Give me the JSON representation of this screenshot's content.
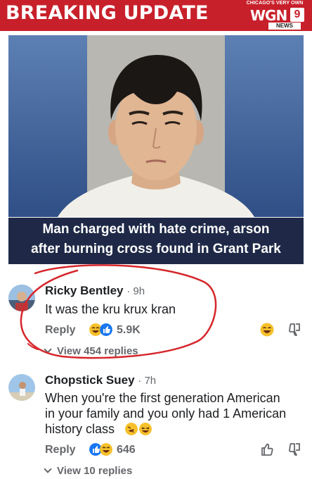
{
  "news": {
    "banner_title": "BREAKING UPDATE",
    "logo": {
      "tagline": "CHICAGO'S VERY OWN",
      "name": "WGN",
      "number": "9",
      "sub": "NEWS"
    },
    "caption_line1": "Man charged with hate crime, arson",
    "caption_line2": "after burning cross found in Grant Park"
  },
  "comments": [
    {
      "author": "Ricky Bentley",
      "time": "· 9h",
      "text": "It was the kru krux kran",
      "reply_label": "Reply",
      "reaction_count": "5.9K",
      "reactions": [
        "laugh-emoji",
        "like-icon"
      ],
      "view_replies": "View 454 replies"
    },
    {
      "author": "Chopstick Suey",
      "time": "· 7h",
      "text_line1": "When you're the first generation American",
      "text_line2": "in your family and you only had 1 American",
      "text_line3": "history class",
      "reply_label": "Reply",
      "reaction_count": "646",
      "reactions": [
        "like-icon",
        "laugh-emoji"
      ],
      "view_replies": "View 10 replies"
    }
  ],
  "colors": {
    "banner_red": "#c8202b",
    "caption_navy": "#1f2947",
    "like_blue": "#1877f2",
    "emoji_yellow": "#f7c02b",
    "annotation_red": "#d6262b"
  }
}
